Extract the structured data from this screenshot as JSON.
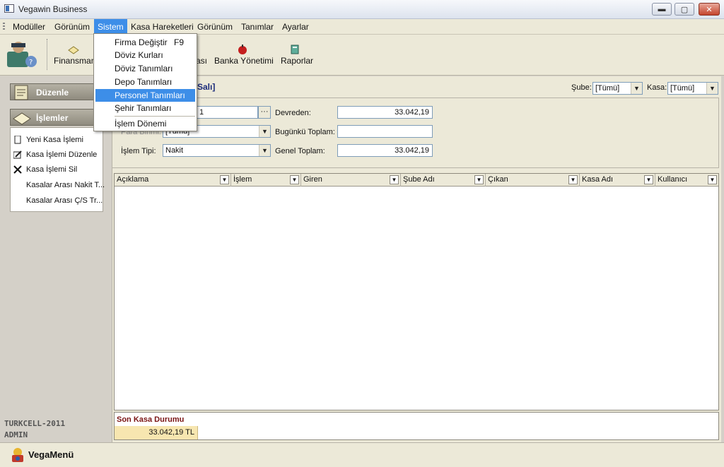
{
  "window": {
    "title": "Vegawin Business",
    "minimize": "▬",
    "maximize": "▢",
    "close": "✕"
  },
  "menubar": [
    "Modüller",
    "Görünüm",
    "Sistem",
    "Kasa Hareketleri",
    "Görünüm",
    "Tanımlar",
    "Ayarlar"
  ],
  "toolbar": {
    "finansman": "Finansman",
    "kasa_partial": "ası",
    "banka": "Banka Yönetimi",
    "raporlar": "Raporlar"
  },
  "sistem_menu": {
    "items": [
      "Firma Değiştir",
      "Döviz Kurları",
      "Döviz Tanımları",
      "Depo Tanımları",
      "Personel Tanımları",
      "Şehir Tanımları",
      "İşlem Dönemi"
    ],
    "shortcut": "F9"
  },
  "left_panel": {
    "duzenle": "Düzenle",
    "islemler": "İşlemler",
    "items": [
      "Yeni Kasa İşlemi",
      "Kasa İşlemi Düzenle",
      "Kasa İşlemi Sil",
      "Kasalar Arası Nakit T...",
      "Kasalar Arası Ç/S Tr..."
    ],
    "footer_company": "TURKCELL-2011",
    "footer_user": "ADMIN"
  },
  "header": {
    "date_suffix": "Salı]",
    "sube_label": "Şube:",
    "sube_value": "[Tümü]",
    "kasa_label": "Kasa:",
    "kasa_value": "[Tümü]"
  },
  "form": {
    "field1_value": "1",
    "dots": "···",
    "para_birimi_label": "Para Birimi:",
    "para_birimi_value": "[Tümü]",
    "islem_tipi_label": "İşlem Tipi:",
    "islem_tipi_value": "Nakit",
    "devreden_label": "Devreden:",
    "devreden_value": "33.042,19",
    "bugunku_label": "Bugünkü Toplam:",
    "bugunku_value": "",
    "genel_label": "Genel Toplam:",
    "genel_value": "33.042,19"
  },
  "grid": {
    "columns": [
      "Açıklama",
      "İşlem",
      "Giren",
      "Şube Adı",
      "Çıkan",
      "Kasa Adı",
      "Kullanıcı"
    ]
  },
  "summary": {
    "title": "Son Kasa Durumu",
    "value": "33.042,19 TL"
  },
  "statusbar": {
    "vegamenu": "VegaMenü"
  },
  "colors": {
    "highlight": "#3d8ee8",
    "summary_title": "#7a1414",
    "summary_bg": "#f7e6b0"
  }
}
